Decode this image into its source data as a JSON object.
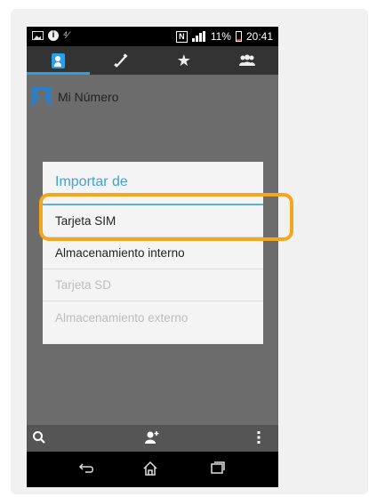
{
  "status_bar": {
    "left_icons": [
      "image-icon",
      "info-icon",
      "signal-icon"
    ],
    "signal_text": "⁴⁄",
    "nfc_label": "N",
    "battery_percent": "11%",
    "time": "20:41"
  },
  "tabs": [
    {
      "icon": "contacts-icon",
      "active": true
    },
    {
      "icon": "phone-icon",
      "active": false
    },
    {
      "icon": "star-icon",
      "active": false
    },
    {
      "icon": "groups-icon",
      "active": false
    }
  ],
  "contact": {
    "name": "Mi Número"
  },
  "dialog": {
    "title": "Importar de",
    "options": [
      {
        "label": "Tarjeta SIM",
        "enabled": true,
        "highlighted": true
      },
      {
        "label": "Almacenamiento interno",
        "enabled": true,
        "highlighted": false
      },
      {
        "label": "Tarjeta SD",
        "enabled": false,
        "highlighted": false
      },
      {
        "label": "Almacenamiento externo",
        "enabled": false,
        "highlighted": false
      }
    ]
  },
  "action_bar": {
    "icons": [
      "search-icon",
      "add-contact-icon",
      "more-options-icon"
    ]
  },
  "nav_bar": {
    "icons": [
      "back-icon",
      "home-icon",
      "recent-apps-icon"
    ]
  },
  "colors": {
    "accent": "#43a0d9",
    "highlight": "#f4a71b"
  }
}
